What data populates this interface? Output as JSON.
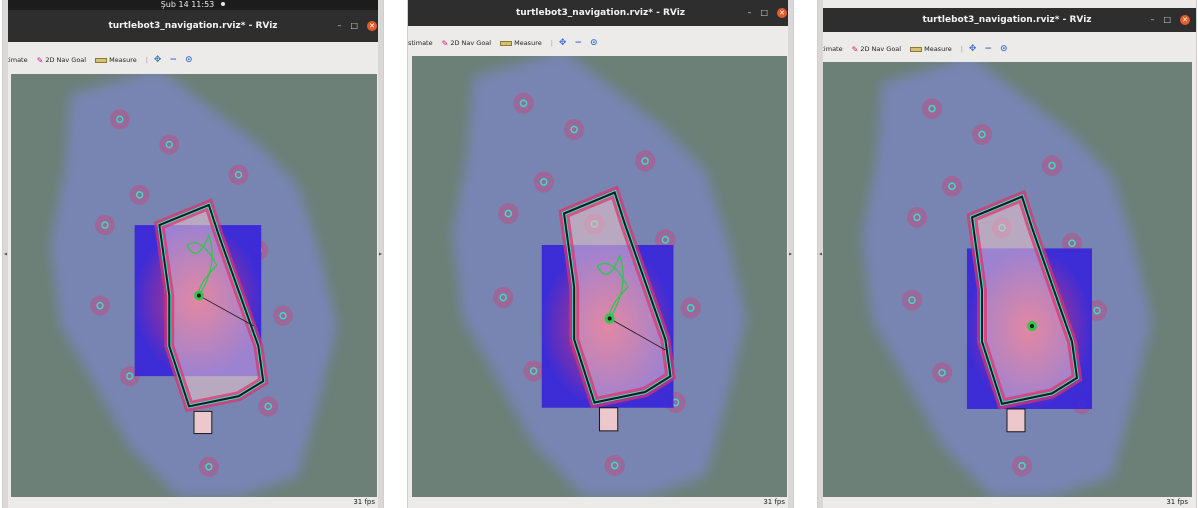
{
  "windows": [
    {
      "id": "left",
      "system_clock": "Şub 14  11:53",
      "title": "turtlebot3_navigation.rviz* - RViz",
      "toolbar": {
        "pose_estimate_label": "stimate",
        "nav_goal_label": "2D Nav Goal",
        "measure_label": "Measure"
      },
      "fps_label": "31 fps"
    },
    {
      "id": "middle",
      "title": "turtlebot3_navigation.rviz* - RViz",
      "toolbar": {
        "pose_estimate_label": "stimate",
        "nav_goal_label": "2D Nav Goal",
        "measure_label": "Measure"
      },
      "fps_label": "31 fps"
    },
    {
      "id": "right",
      "title": "turtlebot3_navigation.rviz* - RViz",
      "toolbar": {
        "pose_estimate_label": "stimate",
        "nav_goal_label": "2D Nav Goal",
        "measure_label": "Measure"
      },
      "fps_label": "31 fps"
    }
  ],
  "window_controls": {
    "minimize": "–",
    "maximize": "□",
    "close": "✕"
  },
  "icons": {
    "nav_goal": "pen-icon",
    "measure": "ruler-icon",
    "camera_move": "move-camera-icon",
    "camera_zoom": "zoom-camera-icon",
    "camera_focus": "focus-camera-icon",
    "splitter": "splitter-arrow-icon"
  },
  "colors": {
    "titlebar": "#2e2e2e",
    "close_button": "#e35d2a",
    "map_background": "#6c8078",
    "costmap_halo": "#7c86c6",
    "local_costmap": "#3a28d8",
    "inflation": "#e0306a",
    "obstacle": "#1a1a1a",
    "free_space": "#ecc8cc",
    "inscribed": "#40d8c8",
    "planned_path": "#22cc44"
  }
}
